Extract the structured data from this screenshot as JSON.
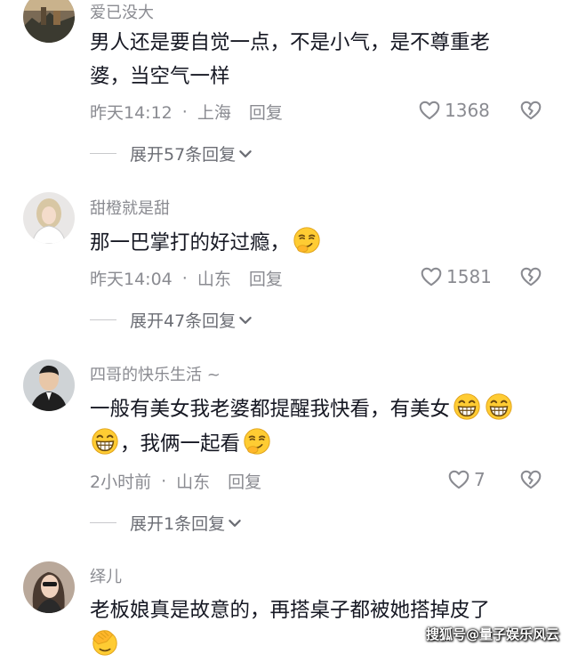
{
  "comments": [
    {
      "username": "爱已没大",
      "text_line1": "男人还是要自觉一点，不是小气，是不尊重老",
      "text_line2": "婆，当空气一样",
      "time": "昨天14:12",
      "location": "上海",
      "reply_label": "回复",
      "likes": "1368",
      "expand_label": "展开57条回复"
    },
    {
      "username": "甜橙就是甜",
      "text_line1": "那一巴掌打的好过瘾，",
      "time": "昨天14:04",
      "location": "山东",
      "reply_label": "回复",
      "likes": "1581",
      "expand_label": "展开47条回复"
    },
    {
      "username": "四哥的快乐生活 ~",
      "text_line1": "一般有美女我老婆都提醒我快看，有美女",
      "text_line2": "，我俩一起看",
      "time": "2小时前",
      "location": "山东",
      "reply_label": "回复",
      "likes": "7",
      "expand_label": "展开1条回复"
    },
    {
      "username": "绎儿",
      "text_line1": "老板娘真是故意的，再搭桌子都被她搭掉皮了"
    }
  ],
  "separator": "·",
  "watermark": "搜狐号@量子娱乐风云",
  "icons": {
    "like": "heart-icon",
    "dislike": "broken-heart-icon",
    "expand": "chevron-down-icon",
    "smirk": "smirk-emoji-icon",
    "grin": "grin-emoji-icon",
    "facepalm": "facepalm-emoji-icon"
  },
  "colors": {
    "text": "#161823",
    "muted": "#8a8b91",
    "emoji": "#ffcc33"
  }
}
